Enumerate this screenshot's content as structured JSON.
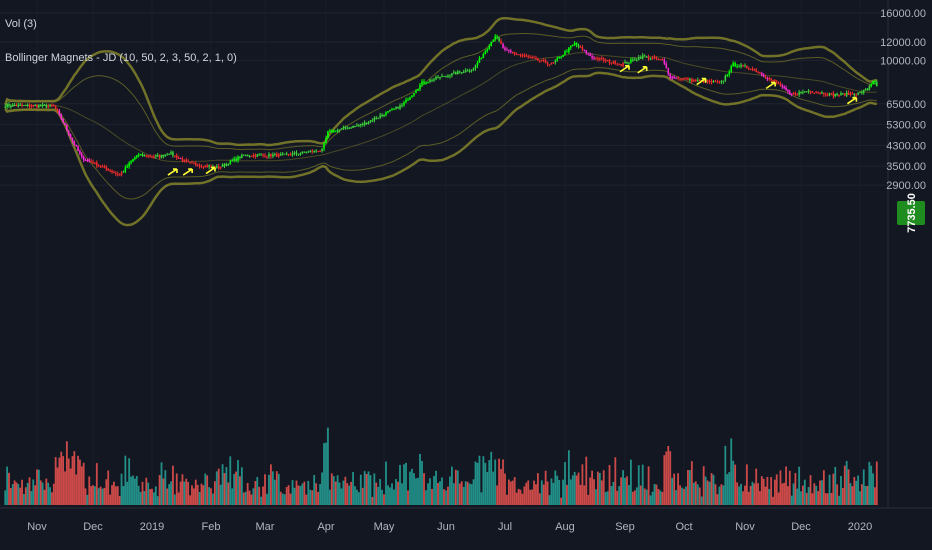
{
  "legend": {
    "volume_label": "Vol (3)",
    "indicator_label": "Bollinger Magnets - JD (10, 50, 2, 3, 50, 2, 1, 0)"
  },
  "current_price": "7735.50",
  "colors": {
    "background": "#131722",
    "grid": "#1f2330",
    "candle_up": "#26a69a",
    "green_candle": "#3ad43a",
    "bright_green": "#00ff00",
    "red_candle": "#ef2b2b",
    "magenta": "#ff2bd6",
    "bands": "#8a8a2a",
    "arrow_yellow": "#ffff33",
    "volume_up": "#26a69a",
    "volume_down": "#ef5350",
    "price_badge": "#1e8c1e"
  },
  "chart_data": {
    "type": "candlestick",
    "x_ticks": [
      "Nov",
      "Dec",
      "2019",
      "Feb",
      "Mar",
      "Apr",
      "May",
      "Jun",
      "Jul",
      "Aug",
      "Sep",
      "Oct",
      "Nov",
      "Dec",
      "2020"
    ],
    "y_ticks": [
      "16000.00",
      "12000.00",
      "10000.00",
      "6500.00",
      "5300.00",
      "4300.00",
      "3500.00",
      "2900.00"
    ],
    "y_scale": "log",
    "y_range": [
      2700,
      16500
    ],
    "price_path": [
      [
        "2018-10-15",
        6400
      ],
      [
        "2018-11-10",
        6350
      ],
      [
        "2018-11-14",
        5600
      ],
      [
        "2018-11-20",
        4500
      ],
      [
        "2018-11-25",
        3800
      ],
      [
        "2018-12-05",
        3500
      ],
      [
        "2018-12-15",
        3200
      ],
      [
        "2018-12-24",
        3900
      ],
      [
        "2019-01-05",
        3850
      ],
      [
        "2019-01-10",
        4000
      ],
      [
        "2019-01-20",
        3600
      ],
      [
        "2019-02-05",
        3450
      ],
      [
        "2019-02-18",
        3900
      ],
      [
        "2019-03-10",
        3900
      ],
      [
        "2019-03-30",
        4100
      ],
      [
        "2019-04-02",
        4900
      ],
      [
        "2019-04-20",
        5300
      ],
      [
        "2019-05-10",
        6400
      ],
      [
        "2019-05-20",
        8000
      ],
      [
        "2019-06-01",
        8600
      ],
      [
        "2019-06-15",
        9200
      ],
      [
        "2019-06-26",
        12800
      ],
      [
        "2019-07-01",
        11000
      ],
      [
        "2019-07-15",
        10200
      ],
      [
        "2019-07-25",
        9600
      ],
      [
        "2019-08-06",
        11800
      ],
      [
        "2019-08-15",
        10300
      ],
      [
        "2019-08-30",
        9600
      ],
      [
        "2019-09-10",
        10400
      ],
      [
        "2019-09-20",
        10000
      ],
      [
        "2019-09-24",
        8500
      ],
      [
        "2019-10-05",
        8200
      ],
      [
        "2019-10-20",
        8000
      ],
      [
        "2019-10-26",
        9600
      ],
      [
        "2019-11-05",
        9200
      ],
      [
        "2019-11-20",
        7800
      ],
      [
        "2019-11-25",
        7100
      ],
      [
        "2019-12-05",
        7400
      ],
      [
        "2019-12-18",
        7100
      ],
      [
        "2019-12-31",
        7200
      ],
      [
        "2020-01-05",
        7500
      ],
      [
        "2020-01-08",
        8200
      ],
      [
        "2020-01-10",
        7735.5
      ]
    ],
    "volume": "relative, unlabeled (Vol 3)"
  }
}
